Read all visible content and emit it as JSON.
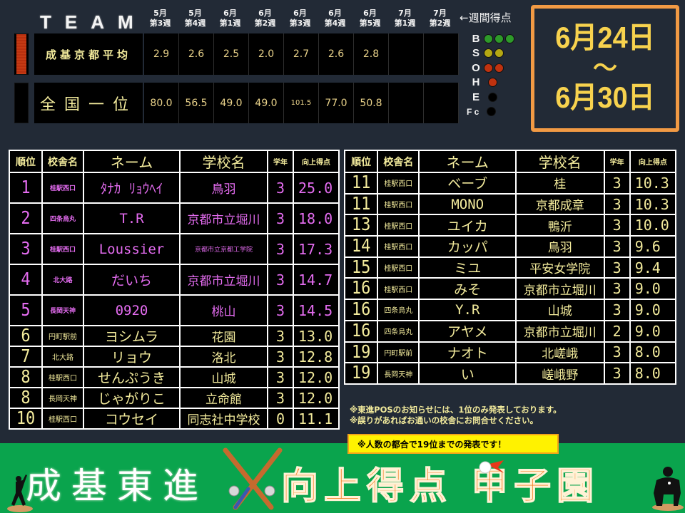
{
  "team_panel": {
    "title": "TEAM",
    "week_headers": [
      {
        "month": "5月",
        "week": "第3週"
      },
      {
        "month": "5月",
        "week": "第4週"
      },
      {
        "month": "6月",
        "week": "第1週"
      },
      {
        "month": "6月",
        "week": "第2週"
      },
      {
        "month": "6月",
        "week": "第3週"
      },
      {
        "month": "6月",
        "week": "第4週"
      },
      {
        "month": "6月",
        "week": "第5週"
      },
      {
        "month": "7月",
        "week": "第1週"
      },
      {
        "month": "7月",
        "week": "第2週"
      }
    ],
    "legend": "←週間得点",
    "rows": [
      {
        "label": "成基京都平均",
        "values": [
          "2.9",
          "2.6",
          "2.5",
          "2.0",
          "2.7",
          "2.6",
          "2.8",
          "",
          ""
        ]
      },
      {
        "label": "全国一位",
        "values": [
          "80.0",
          "56.5",
          "49.0",
          "49.0",
          "101.5",
          "77.0",
          "50.8",
          "",
          ""
        ]
      }
    ]
  },
  "indicators": [
    {
      "letter": "B",
      "lamps": [
        "green",
        "green",
        "green"
      ]
    },
    {
      "letter": "S",
      "lamps": [
        "yellow",
        "yellow"
      ]
    },
    {
      "letter": "O",
      "lamps": [
        "red",
        "red"
      ]
    },
    {
      "letter": "H",
      "lamps": [
        "red"
      ]
    },
    {
      "letter": "E",
      "lamps": [
        "off"
      ]
    },
    {
      "letter": "F c",
      "lamps": [
        "off"
      ]
    }
  ],
  "indicator_colors": {
    "green": "#2e9a2a",
    "yellow": "#b5a813",
    "red": "#c0320f",
    "off": "#000000"
  },
  "date_range": {
    "start": "6月24日",
    "separator": "～",
    "end": "6月30日"
  },
  "rank_table": {
    "headers": [
      "順位",
      "校舎名",
      "ネーム",
      "学校名",
      "学年",
      "向上得点"
    ],
    "left_rows": [
      {
        "rank": "1",
        "campus": "桂駅西口",
        "name": "ﾀﾅｶ ﾘｮｳﾍｲ",
        "school": "鳥羽",
        "grade": "3",
        "score": "25.0"
      },
      {
        "rank": "2",
        "campus": "四条烏丸",
        "name": "T.R",
        "school": "京都市立堀川",
        "grade": "3",
        "score": "18.0"
      },
      {
        "rank": "3",
        "campus": "桂駅西口",
        "name": "Loussier",
        "school": "京都市立京都工学院",
        "grade": "3",
        "score": "17.3"
      },
      {
        "rank": "4",
        "campus": "北大路",
        "name": "だいち",
        "school": "京都市立堀川",
        "grade": "3",
        "score": "14.7"
      },
      {
        "rank": "5",
        "campus": "長岡天神",
        "name": "0920",
        "school": "桃山",
        "grade": "3",
        "score": "14.5"
      },
      {
        "rank": "6",
        "campus": "円町駅前",
        "name": "ヨシムラ",
        "school": "花園",
        "grade": "3",
        "score": "13.0"
      },
      {
        "rank": "7",
        "campus": "北大路",
        "name": "リョウ",
        "school": "洛北",
        "grade": "3",
        "score": "12.8"
      },
      {
        "rank": "8",
        "campus": "桂駅西口",
        "name": "せんぷうき",
        "school": "山城",
        "grade": "3",
        "score": "12.0"
      },
      {
        "rank": "8",
        "campus": "長岡天神",
        "name": "じゃがりこ",
        "school": "立命館",
        "grade": "3",
        "score": "12.0"
      },
      {
        "rank": "10",
        "campus": "桂駅西口",
        "name": "コウセイ",
        "school": "同志社中学校",
        "grade": "0",
        "score": "11.1"
      }
    ],
    "right_rows": [
      {
        "rank": "11",
        "campus": "桂駅西口",
        "name": "ベーブ",
        "school": "桂",
        "grade": "3",
        "score": "10.3"
      },
      {
        "rank": "11",
        "campus": "桂駅西口",
        "name": "MONO",
        "school": "京都成章",
        "grade": "3",
        "score": "10.3"
      },
      {
        "rank": "13",
        "campus": "桂駅西口",
        "name": "ユイカ",
        "school": "鴨沂",
        "grade": "3",
        "score": "10.0"
      },
      {
        "rank": "14",
        "campus": "桂駅西口",
        "name": "カッパ",
        "school": "鳥羽",
        "grade": "3",
        "score": "9.6"
      },
      {
        "rank": "15",
        "campus": "桂駅西口",
        "name": "ミユ",
        "school": "平安女学院",
        "grade": "3",
        "score": "9.4"
      },
      {
        "rank": "16",
        "campus": "桂駅西口",
        "name": "みそ",
        "school": "京都市立堀川",
        "grade": "3",
        "score": "9.0"
      },
      {
        "rank": "16",
        "campus": "四条烏丸",
        "name": "Y.R",
        "school": "山城",
        "grade": "3",
        "score": "9.0"
      },
      {
        "rank": "16",
        "campus": "四条烏丸",
        "name": "アヤメ",
        "school": "京都市立堀川",
        "grade": "2",
        "score": "9.0"
      },
      {
        "rank": "19",
        "campus": "円町駅前",
        "name": "ナオト",
        "school": "北嵯峨",
        "grade": "3",
        "score": "8.0"
      },
      {
        "rank": "19",
        "campus": "長岡天神",
        "name": "い",
        "school": "嵯峨野",
        "grade": "3",
        "score": "8.0"
      }
    ],
    "top_highlight_color": "#e46cf0",
    "standard_text_color": "#f3eb9c"
  },
  "notes": [
    "※東進POSのお知らせには、1位のみ発表しております。",
    "※誤りがあればお通いの校舎にお問合せください。"
  ],
  "callout": "※人数の都合で19位までの発表です！",
  "banner": {
    "left_text": "成基東進",
    "right_text": "向上得点 甲子園",
    "background": "#0aa44d",
    "right_color": "#f47d22"
  }
}
